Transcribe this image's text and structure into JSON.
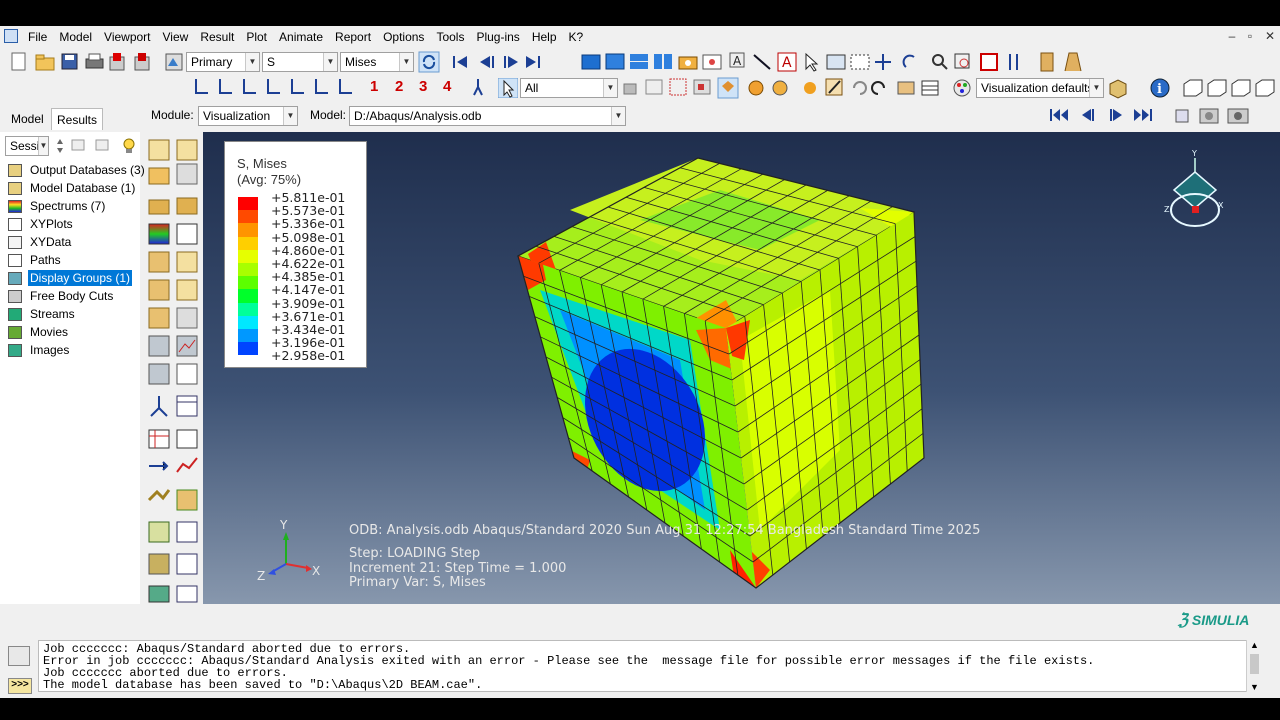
{
  "menu": {
    "items": [
      "File",
      "Model",
      "Viewport",
      "View",
      "Result",
      "Plot",
      "Animate",
      "Report",
      "Options",
      "Tools",
      "Plug-ins",
      "Help",
      "K?"
    ]
  },
  "toolbar1": {
    "primary_select": "Primary",
    "variable_select": "S",
    "invariant_select": "Mises"
  },
  "toolbar2": {
    "step_buttons": [
      "1",
      "2",
      "3",
      "4"
    ],
    "selection_filter": "All",
    "view_defaults": "Visualization defaults"
  },
  "context": {
    "module_label": "Module:",
    "module_value": "Visualization",
    "model_label": "Model:",
    "model_value": "D:/Abaqus/Analysis.odb"
  },
  "tree": {
    "tabs": [
      "Model",
      "Results"
    ],
    "session_select": "Sessio",
    "items": [
      {
        "label": "Output Databases (3)",
        "selected": false
      },
      {
        "label": "Model Database (1)",
        "selected": false
      },
      {
        "label": "Spectrums (7)",
        "selected": false
      },
      {
        "label": "XYPlots",
        "selected": false
      },
      {
        "label": "XYData",
        "selected": false
      },
      {
        "label": "Paths",
        "selected": false
      },
      {
        "label": "Display Groups (1)",
        "selected": true
      },
      {
        "label": "Free Body Cuts",
        "selected": false
      },
      {
        "label": "Streams",
        "selected": false
      },
      {
        "label": "Movies",
        "selected": false
      },
      {
        "label": "Images",
        "selected": false
      }
    ]
  },
  "legend": {
    "title": "S, Mises",
    "subtitle": "(Avg: 75%)",
    "values": [
      "+5.811e-01",
      "+5.573e-01",
      "+5.336e-01",
      "+5.098e-01",
      "+4.860e-01",
      "+4.622e-01",
      "+4.385e-01",
      "+4.147e-01",
      "+3.909e-01",
      "+3.671e-01",
      "+3.434e-01",
      "+3.196e-01",
      "+2.958e-01"
    ],
    "colors": [
      "#ff0000",
      "#ff4a00",
      "#ff9400",
      "#ffcf00",
      "#e6ff00",
      "#a8ff00",
      "#5cff00",
      "#00ff2a",
      "#00ff9a",
      "#00e8ff",
      "#0098ff",
      "#0044ff",
      "#0000d8"
    ]
  },
  "viewport": {
    "odb_line": "ODB: Analysis.odb    Abaqus/Standard 2020    Sun Aug 31 12:27:54 Bangladesh Standard Time 2025",
    "step_line": "Step: LOADING Step",
    "increment_line": "Increment     21: Step Time =     1.000",
    "primary_var_line": "Primary Var: S, Mises",
    "triad": {
      "x": "X",
      "y": "Y",
      "z": "Z"
    },
    "brand": "SIMULIA"
  },
  "messages": [
    "Job ccccccc: Abaqus/Standard aborted due to errors.",
    "Error in job ccccccc: Abaqus/Standard Analysis exited with an error - Please see the  message file for possible error messages if the file exists.",
    "Job ccccccc aborted due to errors.",
    "The model database has been saved to \"D:\\Abaqus\\2D BEAM.cae\"."
  ]
}
